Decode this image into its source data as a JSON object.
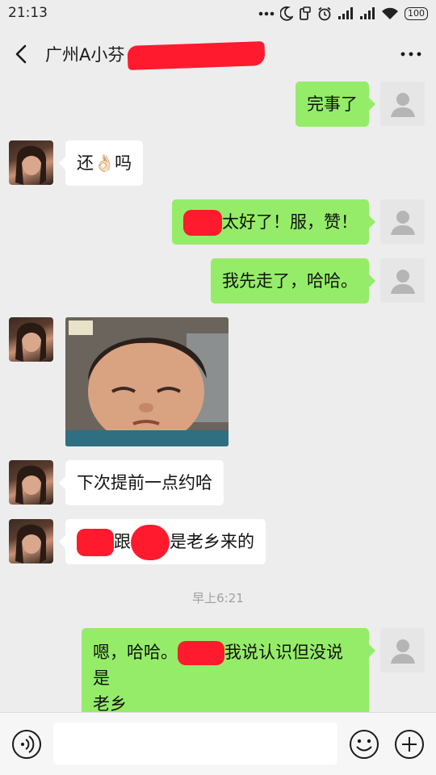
{
  "status_bar": {
    "time": "21:13",
    "battery": "100"
  },
  "header": {
    "title": "广州A小芬"
  },
  "messages": [
    {
      "side": "out",
      "text": "完事了"
    },
    {
      "side": "in",
      "text_a": "还",
      "emoji": "👌🏻",
      "text_b": "吗"
    },
    {
      "side": "out",
      "text": "太好了！服，赞！"
    },
    {
      "side": "out",
      "text": "我先走了，哈哈。"
    },
    {
      "side": "in",
      "type": "photo"
    },
    {
      "side": "in",
      "text": "下次提前一点约哈"
    },
    {
      "side": "in",
      "text_a": "",
      "text_b": "跟",
      "text_c": "是老乡来的"
    },
    {
      "side": "out",
      "text_a": "嗯，哈哈。",
      "text_b": "我说认识但没说是",
      "text_c": "老乡"
    }
  ],
  "timestamp": "早上6:21",
  "input_bar": {
    "value": ""
  },
  "colors": {
    "outgoing": "#95ec69",
    "incoming": "#ffffff",
    "background": "#ededed",
    "redaction": "#ff1a2e"
  }
}
